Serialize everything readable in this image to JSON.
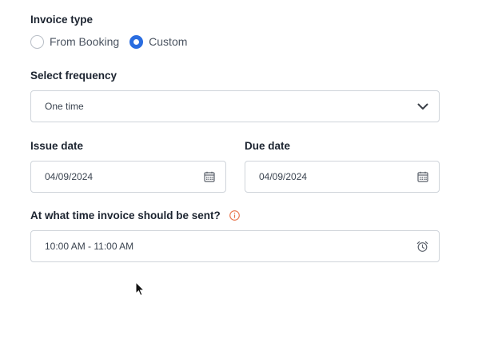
{
  "invoice_type": {
    "label": "Invoice type",
    "options": [
      {
        "label": "From Booking",
        "selected": false
      },
      {
        "label": "Custom",
        "selected": true
      }
    ]
  },
  "frequency": {
    "label": "Select frequency",
    "value": "One time",
    "icon": "chevron-down-icon"
  },
  "issue_date": {
    "label": "Issue date",
    "value": "04/09/2024",
    "icon": "calendar-icon"
  },
  "due_date": {
    "label": "Due date",
    "value": "04/09/2024",
    "icon": "calendar-icon"
  },
  "send_time": {
    "label": "At what time invoice should be sent?",
    "value": "10:00 AM - 11:00 AM",
    "info_icon": "info-icon",
    "icon": "alarm-clock-icon"
  },
  "colors": {
    "accent": "#2a6de0",
    "info": "#e8734a",
    "border": "#cfd4da"
  }
}
